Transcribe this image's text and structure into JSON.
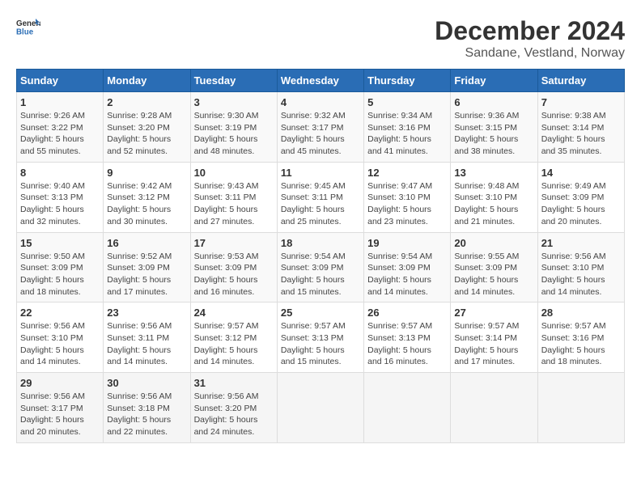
{
  "header": {
    "logo_general": "General",
    "logo_blue": "Blue",
    "title": "December 2024",
    "subtitle": "Sandane, Vestland, Norway"
  },
  "calendar": {
    "days_of_week": [
      "Sunday",
      "Monday",
      "Tuesday",
      "Wednesday",
      "Thursday",
      "Friday",
      "Saturday"
    ],
    "weeks": [
      [
        {
          "day": "1",
          "sunrise": "9:26 AM",
          "sunset": "3:22 PM",
          "daylight": "5 hours and 55 minutes."
        },
        {
          "day": "2",
          "sunrise": "9:28 AM",
          "sunset": "3:20 PM",
          "daylight": "5 hours and 52 minutes."
        },
        {
          "day": "3",
          "sunrise": "9:30 AM",
          "sunset": "3:19 PM",
          "daylight": "5 hours and 48 minutes."
        },
        {
          "day": "4",
          "sunrise": "9:32 AM",
          "sunset": "3:17 PM",
          "daylight": "5 hours and 45 minutes."
        },
        {
          "day": "5",
          "sunrise": "9:34 AM",
          "sunset": "3:16 PM",
          "daylight": "5 hours and 41 minutes."
        },
        {
          "day": "6",
          "sunrise": "9:36 AM",
          "sunset": "3:15 PM",
          "daylight": "5 hours and 38 minutes."
        },
        {
          "day": "7",
          "sunrise": "9:38 AM",
          "sunset": "3:14 PM",
          "daylight": "5 hours and 35 minutes."
        }
      ],
      [
        {
          "day": "8",
          "sunrise": "9:40 AM",
          "sunset": "3:13 PM",
          "daylight": "5 hours and 32 minutes."
        },
        {
          "day": "9",
          "sunrise": "9:42 AM",
          "sunset": "3:12 PM",
          "daylight": "5 hours and 30 minutes."
        },
        {
          "day": "10",
          "sunrise": "9:43 AM",
          "sunset": "3:11 PM",
          "daylight": "5 hours and 27 minutes."
        },
        {
          "day": "11",
          "sunrise": "9:45 AM",
          "sunset": "3:11 PM",
          "daylight": "5 hours and 25 minutes."
        },
        {
          "day": "12",
          "sunrise": "9:47 AM",
          "sunset": "3:10 PM",
          "daylight": "5 hours and 23 minutes."
        },
        {
          "day": "13",
          "sunrise": "9:48 AM",
          "sunset": "3:10 PM",
          "daylight": "5 hours and 21 minutes."
        },
        {
          "day": "14",
          "sunrise": "9:49 AM",
          "sunset": "3:09 PM",
          "daylight": "5 hours and 20 minutes."
        }
      ],
      [
        {
          "day": "15",
          "sunrise": "9:50 AM",
          "sunset": "3:09 PM",
          "daylight": "5 hours and 18 minutes."
        },
        {
          "day": "16",
          "sunrise": "9:52 AM",
          "sunset": "3:09 PM",
          "daylight": "5 hours and 17 minutes."
        },
        {
          "day": "17",
          "sunrise": "9:53 AM",
          "sunset": "3:09 PM",
          "daylight": "5 hours and 16 minutes."
        },
        {
          "day": "18",
          "sunrise": "9:54 AM",
          "sunset": "3:09 PM",
          "daylight": "5 hours and 15 minutes."
        },
        {
          "day": "19",
          "sunrise": "9:54 AM",
          "sunset": "3:09 PM",
          "daylight": "5 hours and 14 minutes."
        },
        {
          "day": "20",
          "sunrise": "9:55 AM",
          "sunset": "3:09 PM",
          "daylight": "5 hours and 14 minutes."
        },
        {
          "day": "21",
          "sunrise": "9:56 AM",
          "sunset": "3:10 PM",
          "daylight": "5 hours and 14 minutes."
        }
      ],
      [
        {
          "day": "22",
          "sunrise": "9:56 AM",
          "sunset": "3:10 PM",
          "daylight": "5 hours and 14 minutes."
        },
        {
          "day": "23",
          "sunrise": "9:56 AM",
          "sunset": "3:11 PM",
          "daylight": "5 hours and 14 minutes."
        },
        {
          "day": "24",
          "sunrise": "9:57 AM",
          "sunset": "3:12 PM",
          "daylight": "5 hours and 14 minutes."
        },
        {
          "day": "25",
          "sunrise": "9:57 AM",
          "sunset": "3:13 PM",
          "daylight": "5 hours and 15 minutes."
        },
        {
          "day": "26",
          "sunrise": "9:57 AM",
          "sunset": "3:13 PM",
          "daylight": "5 hours and 16 minutes."
        },
        {
          "day": "27",
          "sunrise": "9:57 AM",
          "sunset": "3:14 PM",
          "daylight": "5 hours and 17 minutes."
        },
        {
          "day": "28",
          "sunrise": "9:57 AM",
          "sunset": "3:16 PM",
          "daylight": "5 hours and 18 minutes."
        }
      ],
      [
        {
          "day": "29",
          "sunrise": "9:56 AM",
          "sunset": "3:17 PM",
          "daylight": "5 hours and 20 minutes."
        },
        {
          "day": "30",
          "sunrise": "9:56 AM",
          "sunset": "3:18 PM",
          "daylight": "5 hours and 22 minutes."
        },
        {
          "day": "31",
          "sunrise": "9:56 AM",
          "sunset": "3:20 PM",
          "daylight": "5 hours and 24 minutes."
        },
        null,
        null,
        null,
        null
      ]
    ]
  }
}
